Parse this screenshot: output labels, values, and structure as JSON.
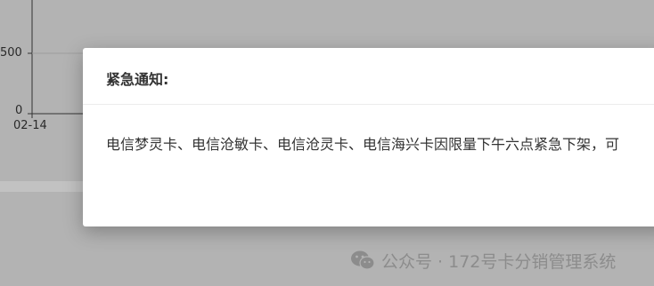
{
  "chart_data": {
    "type": "line",
    "x_tick_labels": [
      "02-14"
    ],
    "y_tick_labels": [
      "500",
      "0"
    ],
    "series": []
  },
  "modal": {
    "title": "紧急通知:",
    "message": "电信梦灵卡、电信沧敏卡、电信沧灵卡、电信海兴卡因限量下午六点紧急下架，可"
  },
  "watermark": {
    "icon": "wechat-icon",
    "text": "公众号 · 172号卡分销管理系统"
  }
}
